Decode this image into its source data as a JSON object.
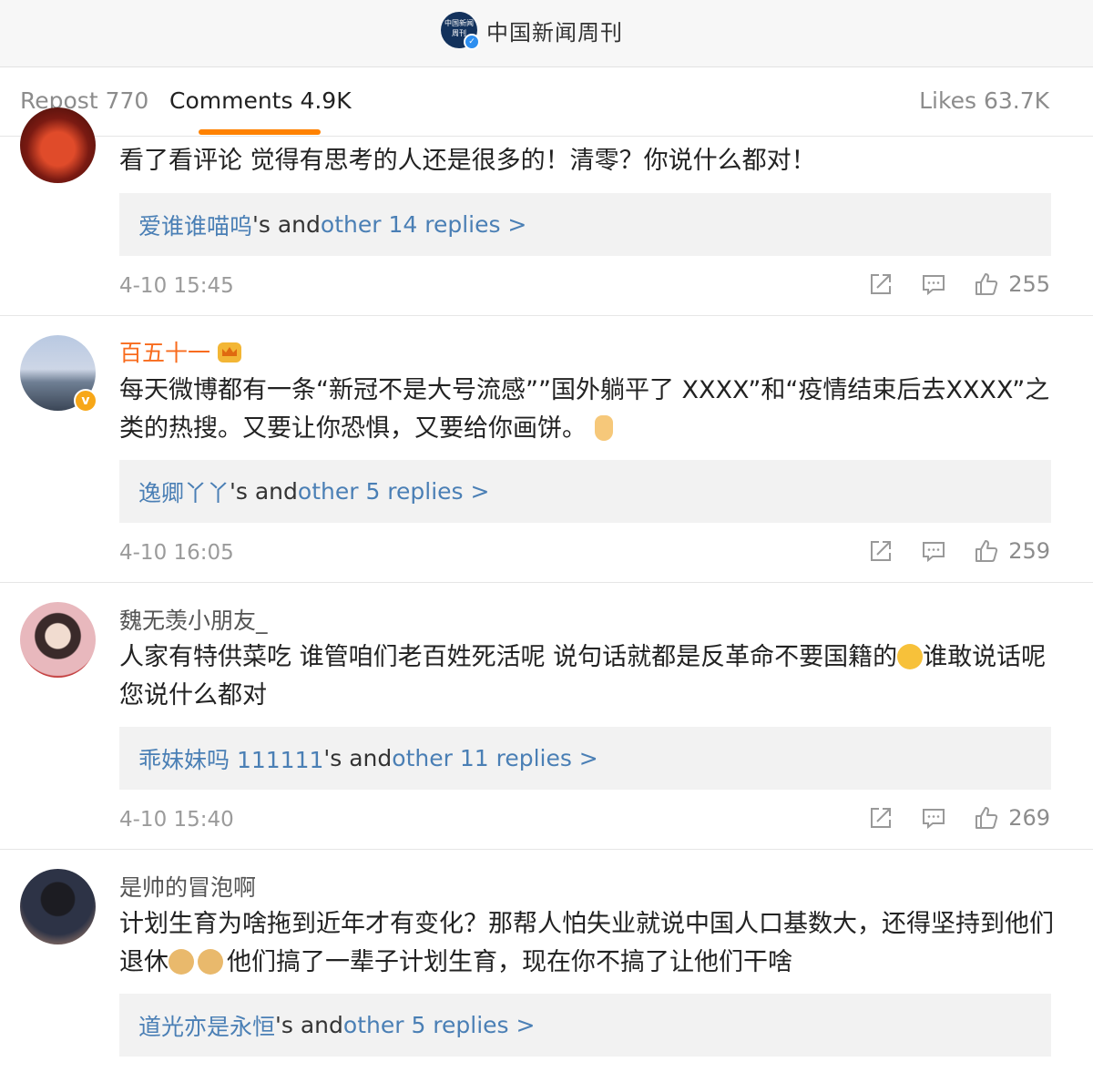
{
  "header": {
    "account_name": "中国新闻周刊",
    "logo_text": "中国新闻周刊"
  },
  "tabs": {
    "repost": "Repost 770",
    "comments": "Comments 4.9K",
    "likes": "Likes 63.7K"
  },
  "comments": [
    {
      "username": "",
      "text": "看了看评论 觉得有思考的人还是很多的！清零？你说什么都对！",
      "reply_user": "爱谁谁喵呜",
      "reply_mid": "'s and ",
      "reply_more": "other 14 replies >",
      "time": "4-10 15:45",
      "likes": "255"
    },
    {
      "username": "百五十一",
      "text_before": "每天微博都有一条“新冠不是大号流感””国外躺平了 XXXX”和“疫情结束后去XXXX”之类的热搜。又要让你恐惧，又要给你画饼。",
      "reply_user": "逸卿丫丫",
      "reply_mid": "'s and ",
      "reply_more": "other 5 replies >",
      "time": "4-10 16:05",
      "likes": "259"
    },
    {
      "username": "魏无羡小朋友_",
      "text_before": "人家有特供菜吃 谁管咱们老百姓死活呢 说句话就都是反革命不要国籍的",
      "text_after": "谁敢说话呢 您说什么都对",
      "reply_user": "乖妹妹吗 111111",
      "reply_mid": "'s and ",
      "reply_more": "other 11 replies >",
      "time": "4-10 15:40",
      "likes": "269"
    },
    {
      "username": "是帅的冒泡啊",
      "text_before": "计划生育为啥拖到近年才有变化？那帮人怕失业就说中国人口基数大，还得坚持到他们退休",
      "text_after": "他们搞了一辈子计划生育，现在你不搞了让他们干啥",
      "reply_user": "道光亦是永恒",
      "reply_mid": "'s and ",
      "reply_more": "other 5 replies >"
    }
  ],
  "colors": {
    "accent": "#ff8200",
    "link": "#4a7fb5",
    "vip_name": "#f86b1d"
  }
}
